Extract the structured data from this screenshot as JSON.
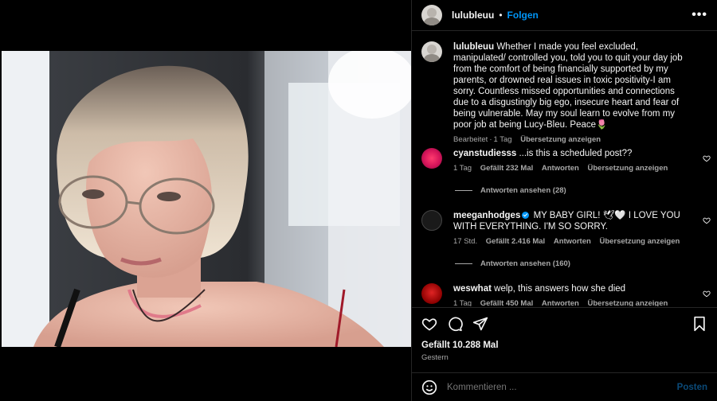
{
  "post": {
    "username": "lulubleuu",
    "separator": "•",
    "follow_label": "Folgen",
    "more_label": "•••"
  },
  "caption": {
    "username": "lulubleuu",
    "text": "Whether I made you feel excluded, manipulated/ controlled you, told you to quit your day job from the comfort of being financially supported by my parents, or drowned real issues in toxic positivity-I am sorry. Countless missed opportunities and connections due to a disgustingly big ego, insecure heart and fear of being vulnerable. May my soul learn to evolve from my poor job at being Lucy-Bleu. Peace🌷",
    "edited": "Bearbeitet",
    "time": "1 Tag",
    "translate": "Übersetzung anzeigen"
  },
  "comments": [
    {
      "username": "cyanstudiesss",
      "text": "...is this a scheduled post??",
      "time": "1 Tag",
      "likes": "Gefällt 232 Mal",
      "reply": "Antworten",
      "translate": "Übersetzung anzeigen",
      "view_replies": "Antworten ansehen (28)"
    },
    {
      "username": "meeganhodges",
      "text": "MY BABY GIRL! 🕊🤍 I LOVE YOU WITH EVERYTHING. I'M SO SORRY.",
      "time": "17 Std.",
      "likes": "Gefällt 2.416 Mal",
      "reply": "Antworten",
      "translate": "Übersetzung anzeigen",
      "view_replies": "Antworten ansehen (160)"
    },
    {
      "username": "weswhat",
      "text": "welp, this answers how she died",
      "time": "1 Tag",
      "likes": "Gefällt 450 Mal",
      "reply": "Antworten",
      "translate": "Übersetzung anzeigen"
    }
  ],
  "footer": {
    "likes": "Gefällt 10.288 Mal",
    "date": "Gestern",
    "comment_placeholder": "Kommentieren ...",
    "post_label": "Posten"
  },
  "icons": {
    "like": "heart-icon",
    "comment": "comment-icon",
    "share": "send-icon",
    "save": "bookmark-icon",
    "emoji": "emoji-icon"
  },
  "colors": {
    "accent": "#0095f6",
    "muted": "#a8a8a8",
    "background": "#000000"
  }
}
